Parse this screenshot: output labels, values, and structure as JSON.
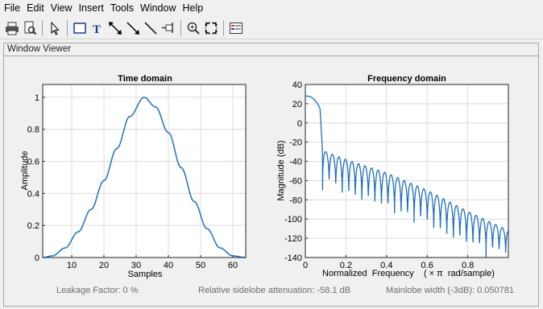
{
  "menu": [
    "File",
    "Edit",
    "View",
    "Insert",
    "Tools",
    "Window",
    "Help"
  ],
  "toolbar": {
    "icons": [
      "print-icon",
      "print-preview-icon",
      "pointer-icon",
      "rectangle-icon",
      "text-icon",
      "double-arrow-icon",
      "arrow-icon",
      "line-icon",
      "pin-icon",
      "zoom-in-icon",
      "fit-icon",
      "legend-icon"
    ]
  },
  "panel": {
    "title": "Window Viewer"
  },
  "status": {
    "leakage": "Leakage Factor: 0 %",
    "sidelobe": "Relative sidelobe attenuation: -58.1 dB",
    "mainlobe": "Mainlobe width (-3dB): 0.050781"
  },
  "colors": {
    "line": "#1f6fbf",
    "grid": "#dcdcdc"
  },
  "chart_data": [
    {
      "type": "line",
      "title": "Time domain",
      "xlabel": "Samples",
      "ylabel": "Amplitude",
      "xlim": [
        1,
        64
      ],
      "ylim": [
        0,
        1.08
      ],
      "xticks": [
        10,
        20,
        30,
        40,
        50,
        60
      ],
      "yticks": [
        0,
        0.2,
        0.4,
        0.6,
        0.8,
        1
      ],
      "ytick_labels": [
        "0",
        "0.2",
        "0.4",
        "0.6",
        "0.8",
        "1"
      ],
      "grid": true,
      "series": [
        {
          "x": [
            1,
            4,
            8,
            12,
            16,
            20,
            24,
            28,
            32.5,
            36,
            40,
            44,
            48,
            52,
            56,
            60,
            64
          ],
          "y": [
            0,
            0.01,
            0.06,
            0.16,
            0.3,
            0.48,
            0.68,
            0.88,
            1.0,
            0.94,
            0.78,
            0.56,
            0.35,
            0.18,
            0.06,
            0.01,
            0
          ]
        }
      ]
    },
    {
      "type": "line",
      "title": "Frequency domain",
      "xlabel": "Normalized  Frequency    ( × π  rad/sample)",
      "ylabel": "Magnitude (dB)",
      "xlim": [
        0,
        1
      ],
      "ylim": [
        -140,
        40
      ],
      "xticks": [
        0,
        0.2,
        0.4,
        0.6,
        0.8
      ],
      "xtick_labels": [
        "0",
        "0.2",
        "0.4",
        "0.6",
        "0.8"
      ],
      "yticks": [
        -140,
        -120,
        -100,
        -80,
        -60,
        -40,
        -20,
        0,
        20,
        40
      ],
      "grid": true,
      "series": [
        {
          "envelope": {
            "x": [
              0,
              0.02,
              0.05,
              0.08,
              0.1,
              0.2,
              0.4,
              0.6,
              0.8,
              1.0
            ],
            "y": [
              28,
              26,
              14,
              -25,
              -30,
              -38,
              -52,
              -70,
              -92,
              -112
            ]
          },
          "null_depth": [
            -70,
            -80,
            -85,
            -90,
            -95,
            -100,
            -105,
            -110,
            -118,
            -125,
            -130,
            -135,
            -140
          ]
        }
      ]
    }
  ]
}
